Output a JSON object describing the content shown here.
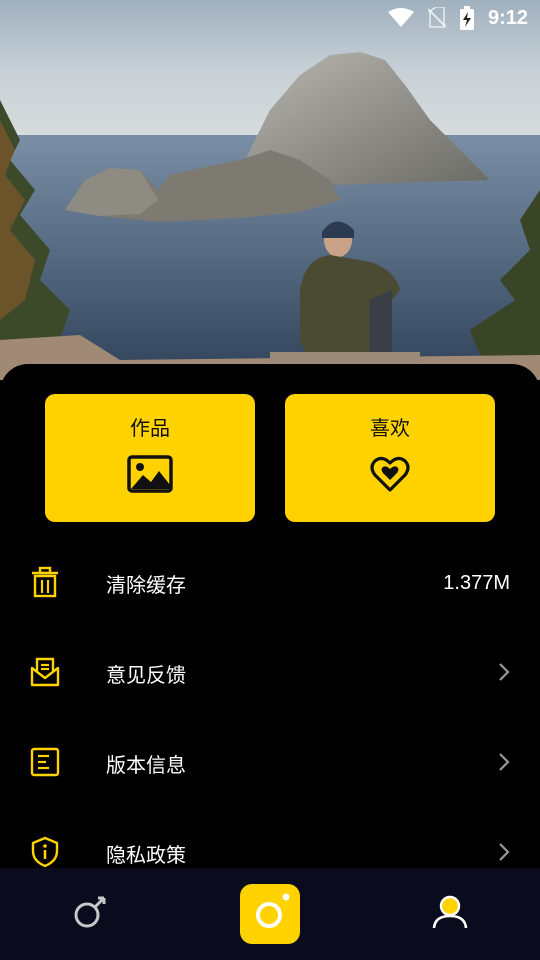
{
  "status_bar": {
    "time": "9:12",
    "icons": [
      "wifi-icon",
      "no-sim-icon",
      "battery-charging-icon"
    ]
  },
  "hero": {
    "description_icon": "landscape-photo"
  },
  "cards": [
    {
      "label": "作品",
      "icon": "image-icon"
    },
    {
      "label": "喜欢",
      "icon": "heart-icon"
    }
  ],
  "menu": [
    {
      "label": "清除缓存",
      "value": "1.377M",
      "icon": "trash-icon"
    },
    {
      "label": "意见反馈",
      "icon": "mail-icon",
      "trailing": "chevron-right-icon"
    },
    {
      "label": "版本信息",
      "icon": "document-icon",
      "trailing": "chevron-right-icon"
    },
    {
      "label": "隐私政策",
      "icon": "shield-info-icon",
      "trailing": "chevron-right-icon"
    }
  ],
  "bottom_nav": {
    "items": [
      "male-icon",
      "camera-icon",
      "profile-icon"
    ]
  },
  "colors": {
    "accent": "#FFD200",
    "background": "#000000",
    "nav_background": "#0B0B1E",
    "chevron": "#9A9A9A"
  }
}
